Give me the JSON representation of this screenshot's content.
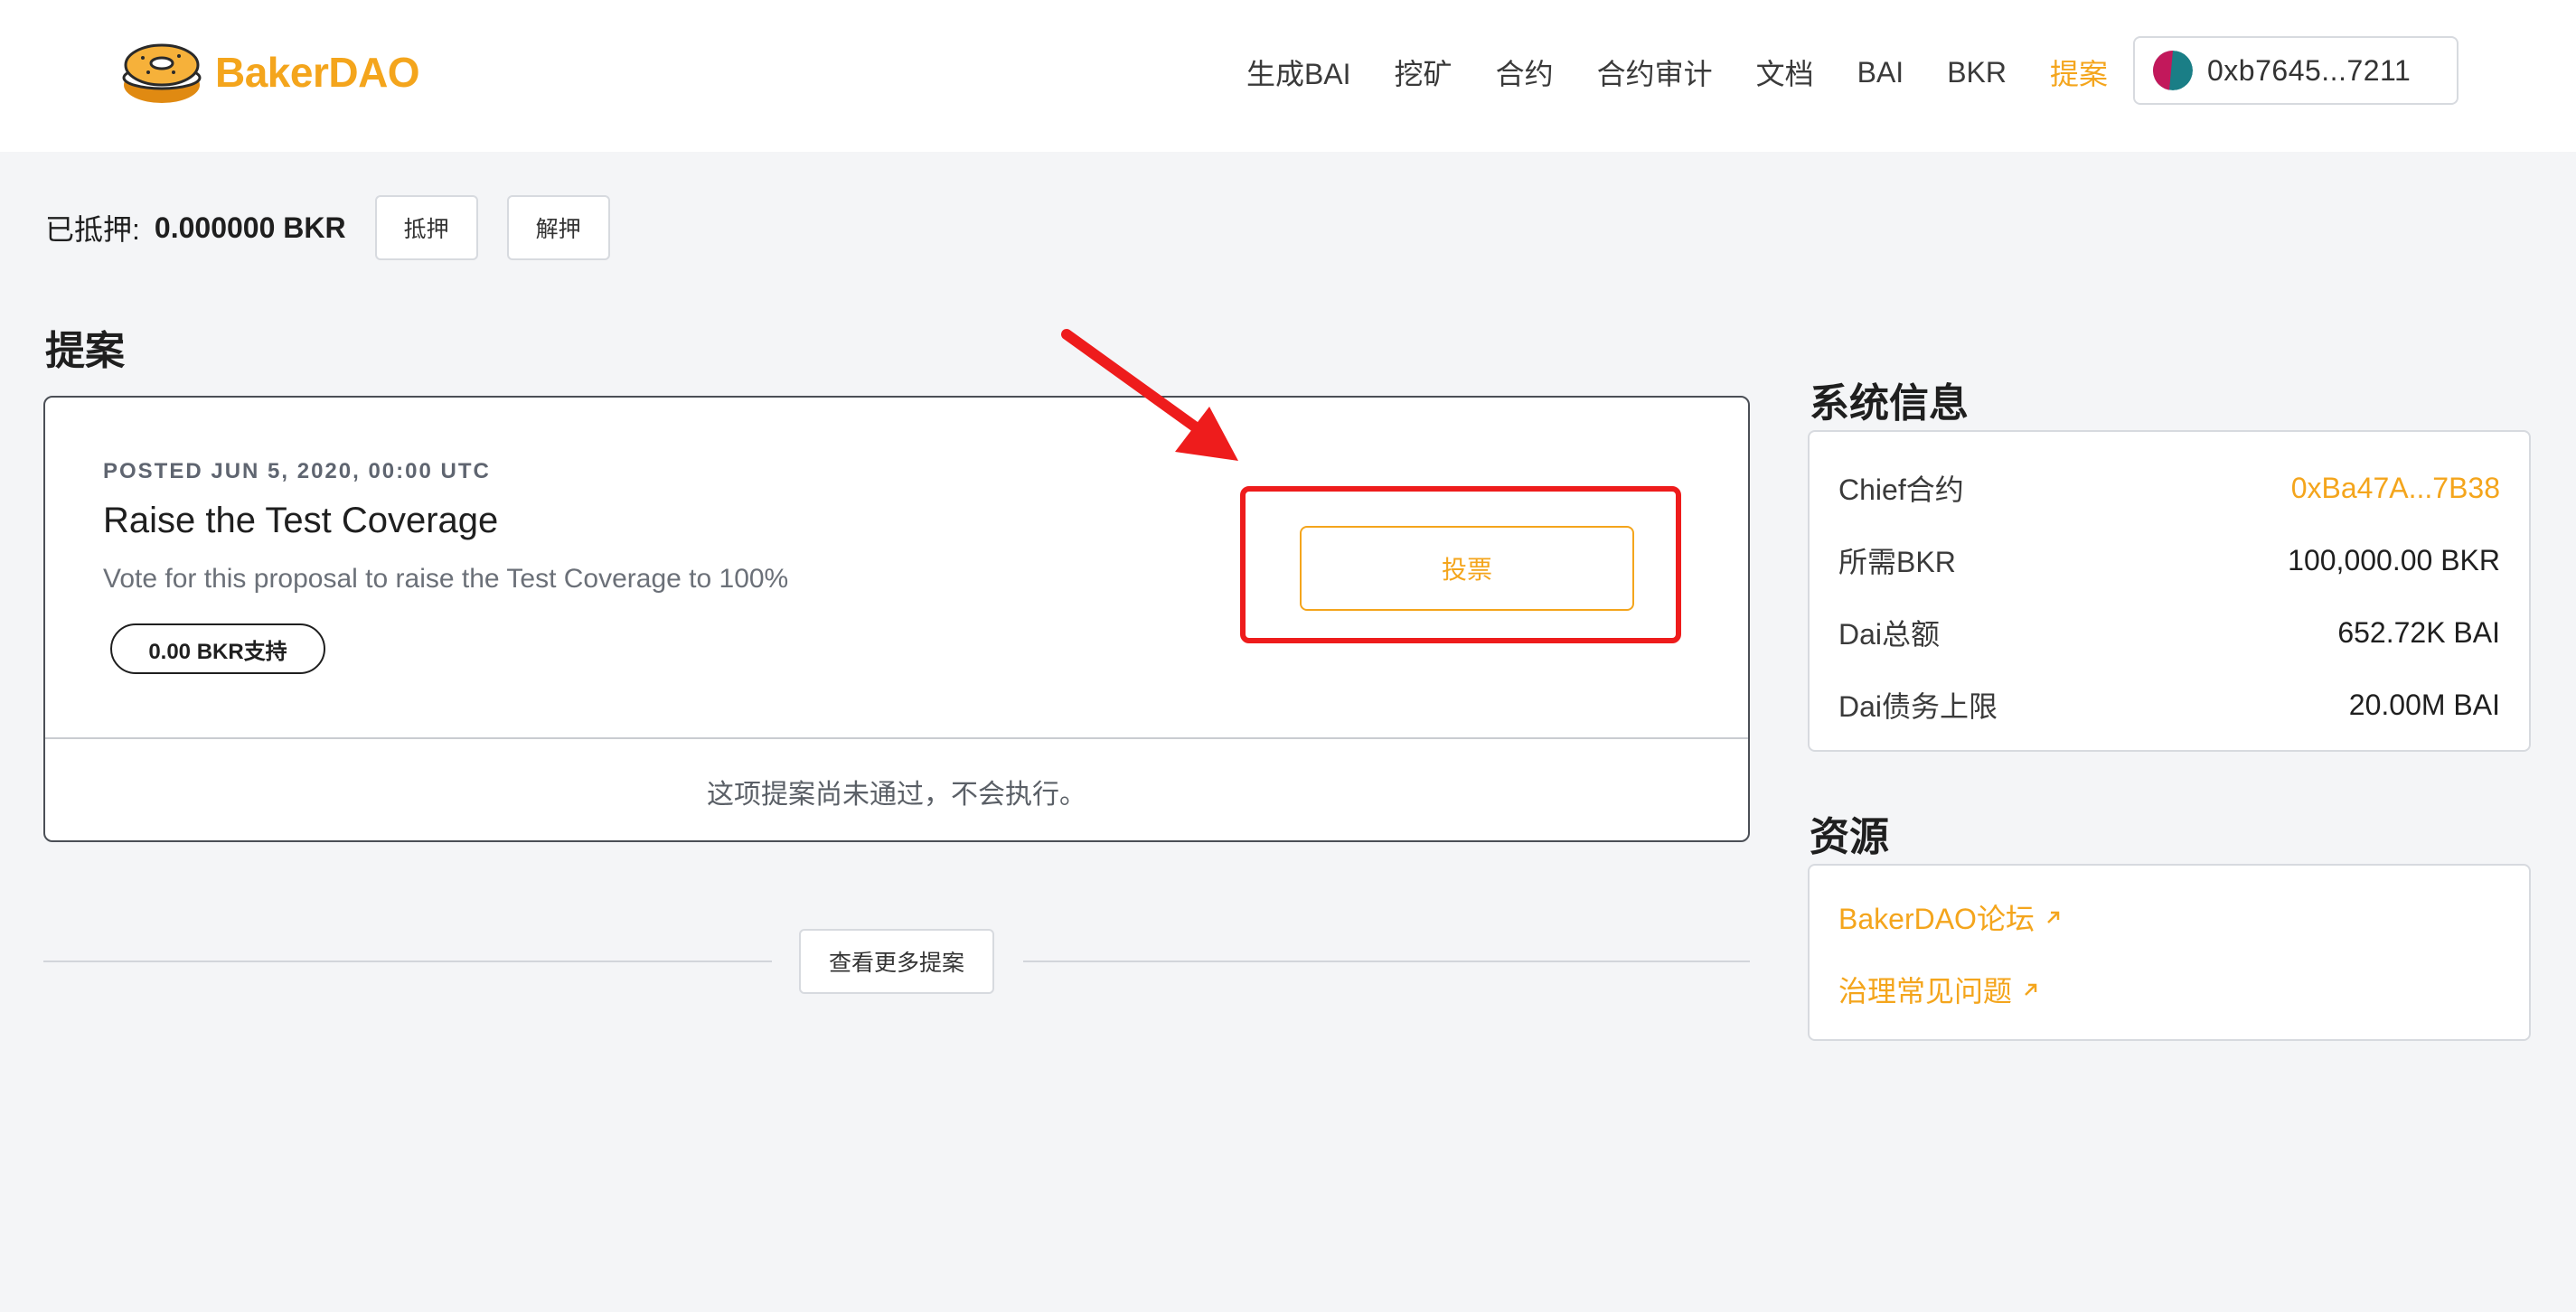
{
  "header": {
    "brand_name": "BakerDAO",
    "nav": [
      {
        "label": "生成BAI"
      },
      {
        "label": "挖矿"
      },
      {
        "label": "合约"
      },
      {
        "label": "合约审计"
      },
      {
        "label": "文档"
      },
      {
        "label": "BAI"
      },
      {
        "label": "BKR"
      },
      {
        "label": "提案",
        "active": true
      }
    ],
    "wallet_address": "0xb7645...7211"
  },
  "stake": {
    "label": "已抵押:",
    "value": "0.000000 BKR",
    "stake_button": "抵押",
    "unstake_button": "解押"
  },
  "proposals": {
    "section_title": "提案",
    "items": [
      {
        "posted": "POSTED JUN 5, 2020, 00:00 UTC",
        "title": "Raise the Test Coverage",
        "description": "Vote for this proposal to raise the Test Coverage to 100%",
        "support": "0.00 BKR支持",
        "vote_button": "投票",
        "status": "这项提案尚未通过，不会执行。"
      }
    ],
    "more_button": "查看更多提案"
  },
  "system_info": {
    "title": "系统信息",
    "rows": [
      {
        "key": "Chief合约",
        "value": "0xBa47A...7B38",
        "link": true
      },
      {
        "key": "所需BKR",
        "value": "100,000.00 BKR"
      },
      {
        "key": "Dai总额",
        "value": "652.72K BAI"
      },
      {
        "key": "Dai债务上限",
        "value": "20.00M BAI"
      }
    ]
  },
  "resources": {
    "title": "资源",
    "links": [
      {
        "label": "BakerDAO论坛"
      },
      {
        "label": "治理常见问题"
      }
    ]
  },
  "colors": {
    "accent": "#f4a51c",
    "annotation_red": "#ee1c1c",
    "background": "#f4f5f7"
  }
}
